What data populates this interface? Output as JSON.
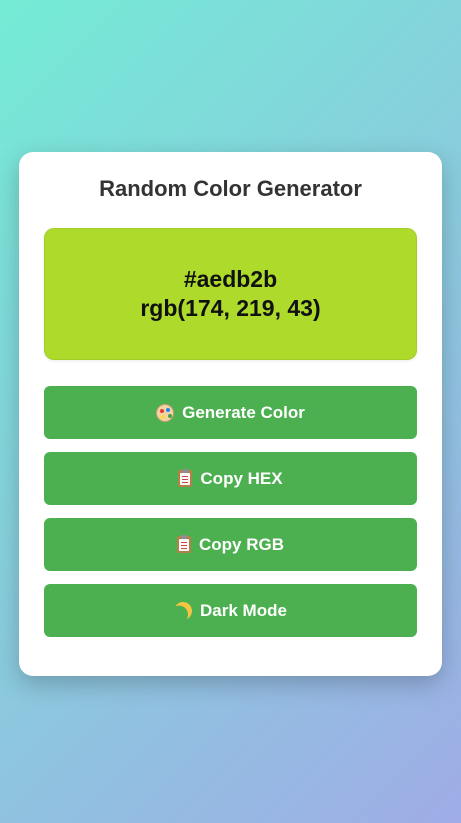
{
  "app": {
    "title": "Random Color Generator"
  },
  "color": {
    "hex": "#aedb2b",
    "rgb": "rgb(174, 219, 43)",
    "swatch_hex": "#aedb2b"
  },
  "buttons": {
    "generate": {
      "label": "Generate Color",
      "icon": "palette-icon"
    },
    "copy_hex": {
      "label": "Copy HEX",
      "icon": "clipboard-icon"
    },
    "copy_rgb": {
      "label": "Copy RGB",
      "icon": "clipboard-icon"
    },
    "dark_mode": {
      "label": "Dark Mode",
      "icon": "moon-icon"
    }
  },
  "theme": {
    "button_color": "#4caf50",
    "background_gradient": [
      "#74ebd5",
      "#9face6"
    ]
  }
}
